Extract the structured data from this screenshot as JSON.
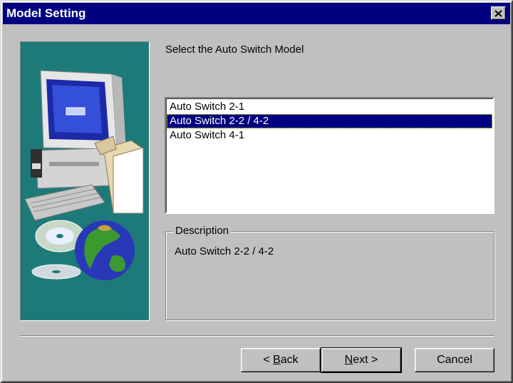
{
  "window": {
    "title": "Model Setting"
  },
  "prompt": "Select the Auto Switch Model",
  "models": [
    {
      "label": "Auto Switch 2-1",
      "selected": false
    },
    {
      "label": "Auto Switch 2-2 / 4-2",
      "selected": true
    },
    {
      "label": "Auto Switch 4-1",
      "selected": false
    }
  ],
  "description": {
    "legend": "Description",
    "text": "Auto Switch 2-2 / 4-2"
  },
  "buttons": {
    "back": {
      "pre": "< ",
      "accel": "B",
      "post": "ack"
    },
    "next": {
      "accel": "N",
      "post": "ext >"
    },
    "cancel": "Cancel"
  },
  "colors": {
    "titlebar": "#000080",
    "side_panel": "#1e7a78",
    "selection": "#000080"
  },
  "icons": [
    "close-icon",
    "computer-illustration",
    "cd-disc-icon",
    "globe-icon"
  ]
}
